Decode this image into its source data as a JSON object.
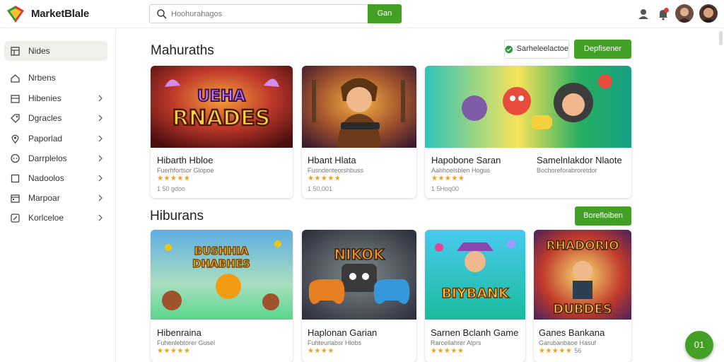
{
  "header": {
    "brand": "MarketBlale",
    "search_placeholder": "Hoohurahagos",
    "search_button": "Gan",
    "notification_badge": "•"
  },
  "sidebar": {
    "items": [
      {
        "label": "Nides",
        "icon": "grid-icon",
        "active": true,
        "chevron": false
      },
      {
        "label": "Nrbens",
        "icon": "home-icon",
        "active": false,
        "chevron": false
      },
      {
        "label": "Hibenies",
        "icon": "store-icon",
        "active": false,
        "chevron": true
      },
      {
        "label": "Dgracles",
        "icon": "tag-icon",
        "active": false,
        "chevron": true
      },
      {
        "label": "Paporlad",
        "icon": "location-icon",
        "active": false,
        "chevron": true
      },
      {
        "label": "Darrplelos",
        "icon": "chat-icon",
        "active": false,
        "chevron": true
      },
      {
        "label": "Nadoolos",
        "icon": "square-icon",
        "active": false,
        "chevron": true
      },
      {
        "label": "Marpoar",
        "icon": "calendar-icon",
        "active": false,
        "chevron": true
      },
      {
        "label": "Korlceloe",
        "icon": "edit-icon",
        "active": false,
        "chevron": true
      }
    ]
  },
  "sections": [
    {
      "title": "Mahuraths",
      "actions": [
        {
          "label": "Sarheleelactoe",
          "style": "outline",
          "icon": "shield-icon"
        },
        {
          "label": "Depfisener",
          "style": "green"
        }
      ],
      "cards": [
        {
          "title": "Hibarth Hbloe",
          "subtitle": "Fuerhfortsor Glopoe",
          "stars": "★★★★★",
          "rating": "",
          "price": "1 50 gdoo",
          "art": "UNEHA RNADES"
        },
        {
          "title": "Hbant Hlata",
          "subtitle": "Fusndenteorshbuss",
          "stars": "★★★★★",
          "rating": "",
          "price": "1 50,001",
          "art": ""
        },
        {
          "title": "Hapobone Saran",
          "subtitle": "Aahhoelsblen Hogus",
          "stars": "★★★★★",
          "rating": "",
          "price": "1 5Hoq00",
          "art": ""
        },
        {
          "title": "Samelnlakdor Nlaote",
          "subtitle": "Bochoreforabroretdor",
          "stars": "",
          "rating": "",
          "price": "",
          "art": ""
        }
      ]
    },
    {
      "title": "Hiburans",
      "actions": [
        {
          "label": "Borefloiben",
          "style": "green"
        }
      ],
      "cards": [
        {
          "title": "Hibenraina",
          "subtitle": "Fuhenlebtorer Gusel",
          "stars": "★★★★★",
          "rating": "",
          "price": "",
          "art": "BUSHHIA DHABHES"
        },
        {
          "title": "Haplonan Garian",
          "subtitle": "Fuhteurlabsr Hlobs",
          "stars": "★★★★",
          "rating": "",
          "price": "",
          "art": "NIKOK"
        },
        {
          "title": "Sarnen Bclanh Game",
          "subtitle": "Rarcellahrer Alprs",
          "stars": "★★★★★",
          "rating": "",
          "price": "",
          "art": "BIYBANK"
        },
        {
          "title": "Ganes Bankana",
          "subtitle": "Garubanbaoe Hasuf",
          "stars": "★★★★★",
          "rating": "56",
          "price": "",
          "art": "RHADORIO DUBDES"
        }
      ]
    }
  ],
  "fab_label": "01",
  "colors": {
    "accent": "#43a027",
    "star": "#f2a014",
    "sidebar_active": "#eef0ec"
  }
}
